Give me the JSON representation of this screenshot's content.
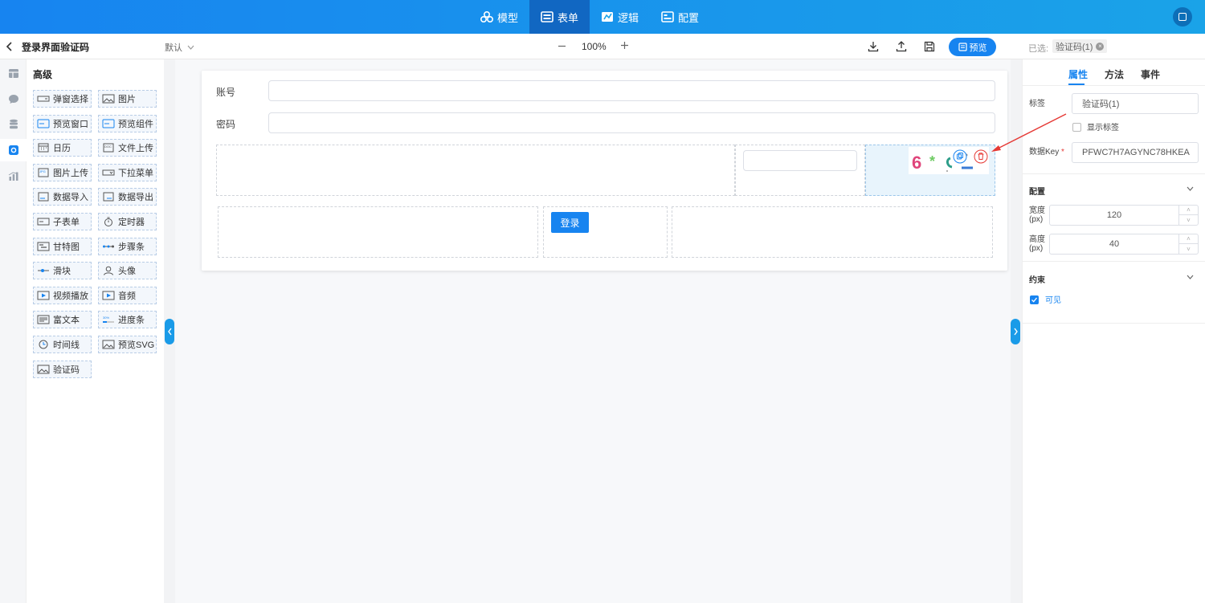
{
  "topnav": {
    "tabs": [
      {
        "label": "模型",
        "icon": "model-icon"
      },
      {
        "label": "表单",
        "icon": "form-icon",
        "active": true
      },
      {
        "label": "逻辑",
        "icon": "logic-icon"
      },
      {
        "label": "配置",
        "icon": "config-icon"
      }
    ]
  },
  "toolbar": {
    "title": "登录界面验证码",
    "version": "默认",
    "zoom": "100%",
    "preview_label": "预览",
    "selected_label": "已选:",
    "selected_tag": "验证码(1)"
  },
  "palette": {
    "title": "高级",
    "items": [
      "弹窗选择",
      "图片",
      "预览窗口",
      "预览组件",
      "日历",
      "文件上传",
      "图片上传",
      "下拉菜单",
      "数据导入",
      "数据导出",
      "子表单",
      "定时器",
      "甘特图",
      "步骤条",
      "滑块",
      "头像",
      "视频播放",
      "音频",
      "富文本",
      "进度条",
      "时间线",
      "预览SVG",
      "验证码"
    ]
  },
  "form": {
    "account_label": "账号",
    "password_label": "密码",
    "login_label": "登录"
  },
  "props": {
    "tabs": [
      "属性",
      "方法",
      "事件"
    ],
    "label_label": "标签",
    "label_value": "验证码(1)",
    "show_label": "显示标签",
    "key_label": "数据Key",
    "key_value": "PFWC7H7AGYNC78HKEA",
    "config_section": "配置",
    "width_label": "宽度",
    "width_unit": "(px)",
    "width_value": "120",
    "height_label": "高度",
    "height_unit": "(px)",
    "height_value": "40",
    "constraint_section": "约束",
    "visible_label": "可见"
  },
  "colors": {
    "primary": "#1784f0",
    "nav_active": "#1167c2",
    "annotation_arrow": "#e53935"
  }
}
